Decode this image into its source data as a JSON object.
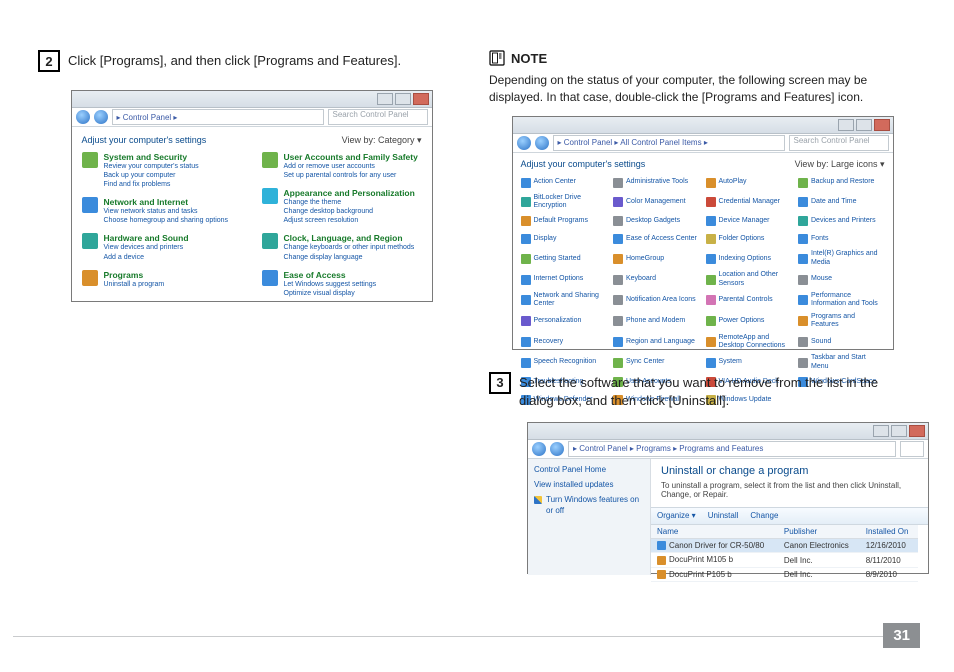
{
  "page_number": "31",
  "left": {
    "step2_num": "2",
    "step2_text": "Click [Programs], and then click [Programs and Features].",
    "shotA": {
      "breadcrumb": "▸ Control Panel ▸",
      "search": "Search Control Panel",
      "adjust": "Adjust your computer's settings",
      "viewby": "View by:   Category ▾",
      "cats_left": [
        {
          "title": "System and Security",
          "subs": [
            "Review your computer's status",
            "Back up your computer",
            "Find and fix problems"
          ]
        },
        {
          "title": "Network and Internet",
          "subs": [
            "View network status and tasks",
            "Choose homegroup and sharing options"
          ]
        },
        {
          "title": "Hardware and Sound",
          "subs": [
            "View devices and printers",
            "Add a device"
          ]
        },
        {
          "title": "Programs",
          "subs": [
            "Uninstall a program"
          ]
        }
      ],
      "cats_right": [
        {
          "title": "User Accounts and Family Safety",
          "subs": [
            "Add or remove user accounts",
            "Set up parental controls for any user"
          ]
        },
        {
          "title": "Appearance and Personalization",
          "subs": [
            "Change the theme",
            "Change desktop background",
            "Adjust screen resolution"
          ]
        },
        {
          "title": "Clock, Language, and Region",
          "subs": [
            "Change keyboards or other input methods",
            "Change display language"
          ]
        },
        {
          "title": "Ease of Access",
          "subs": [
            "Let Windows suggest settings",
            "Optimize visual display"
          ]
        }
      ]
    }
  },
  "right": {
    "note_title": "NOTE",
    "note_body": "Depending on the status of your computer, the following screen may be displayed. In that case, double-click the [Programs and Features] icon.",
    "shotB": {
      "breadcrumb": "▸ Control Panel ▸ All Control Panel Items ▸",
      "search": "Search Control Panel",
      "adjust": "Adjust your computer's settings",
      "viewby": "View by:   Large icons ▾",
      "items": [
        "Action Center",
        "Administrative Tools",
        "AutoPlay",
        "Backup and Restore",
        "BitLocker Drive Encryption",
        "Color Management",
        "Credential Manager",
        "Date and Time",
        "Default Programs",
        "Desktop Gadgets",
        "Device Manager",
        "Devices and Printers",
        "Display",
        "Ease of Access Center",
        "Folder Options",
        "Fonts",
        "Getting Started",
        "HomeGroup",
        "Indexing Options",
        "Intel(R) Graphics and Media",
        "Internet Options",
        "Keyboard",
        "Location and Other Sensors",
        "Mouse",
        "Network and Sharing Center",
        "Notification Area Icons",
        "Parental Controls",
        "Performance Information and Tools",
        "Personalization",
        "Phone and Modem",
        "Power Options",
        "Programs and Features",
        "Recovery",
        "Region and Language",
        "RemoteApp and Desktop Connections",
        "Sound",
        "Speech Recognition",
        "Sync Center",
        "System",
        "Taskbar and Start Menu",
        "Troubleshooting",
        "User Accounts",
        "VIA HD Audio Deck",
        "Windows CardSpace",
        "Windows Defender",
        "Windows Firewall",
        "Windows Update",
        ""
      ]
    },
    "step3_num": "3",
    "step3_text": "Select the software that you want to remove from the list in the dialog box, and then click [Uninstall].",
    "shotC": {
      "breadcrumb": "▸ Control Panel ▸ Programs ▸ Programs and Features",
      "side_home": "Control Panel Home",
      "side_link1": "View installed updates",
      "side_link2": "Turn Windows features on or off",
      "title": "Uninstall or change a program",
      "desc": "To uninstall a program, select it from the list and then click Uninstall, Change, or Repair.",
      "organize": "Organize ▾",
      "uninstall": "Uninstall",
      "change": "Change",
      "th_name": "Name",
      "th_pub": "Publisher",
      "th_date": "Installed On",
      "rows": [
        {
          "name": "Canon Driver for CR-50/80",
          "pub": "Canon Electronics",
          "date": "12/16/2010"
        },
        {
          "name": "DocuPrint M105 b",
          "pub": "Dell Inc.",
          "date": "8/11/2010"
        },
        {
          "name": "DocuPrint P105 b",
          "pub": "Dell Inc.",
          "date": "8/9/2010"
        }
      ]
    }
  }
}
